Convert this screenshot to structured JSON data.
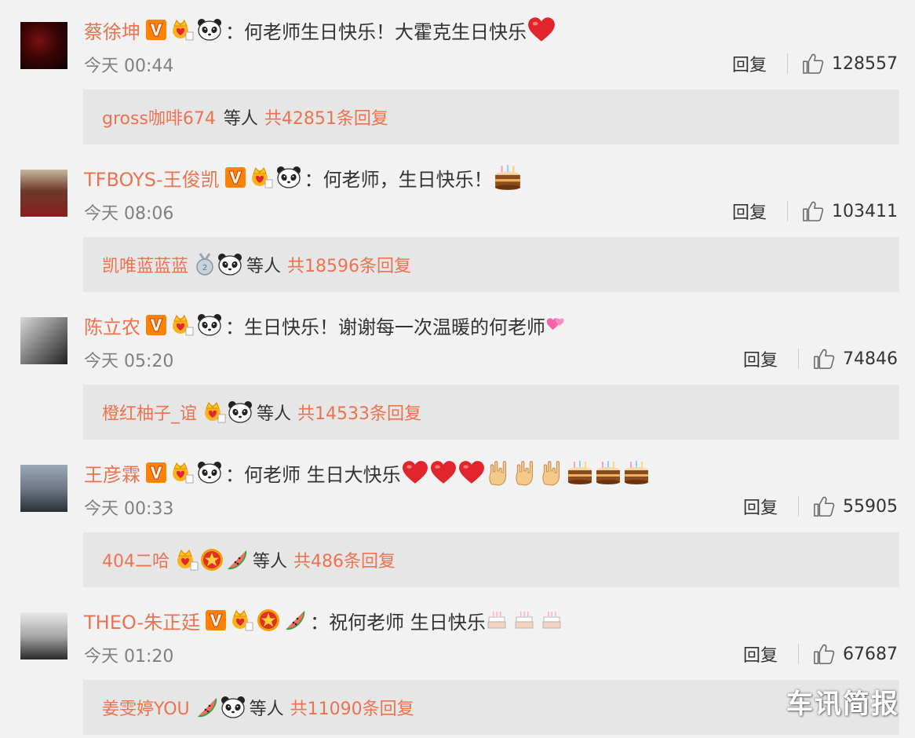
{
  "comments": [
    {
      "username": "蔡徐坤",
      "text": "何老师生日快乐！大霍克生日快乐",
      "time": "今天 00:44",
      "reply_label": "回复",
      "likes": "128557",
      "sub_user": "gross咖啡674",
      "sub_etc": "等人",
      "sub_total": "共42851条回复"
    },
    {
      "username": "TFBOYS-王俊凯",
      "text": "何老师，生日快乐！",
      "time": "今天 08:06",
      "reply_label": "回复",
      "likes": "103411",
      "sub_user": "凯唯蓝蓝蓝",
      "sub_etc": "等人",
      "sub_total": "共18596条回复"
    },
    {
      "username": "陈立农",
      "text": "生日快乐！谢谢每一次温暖的何老师",
      "time": "今天 05:20",
      "reply_label": "回复",
      "likes": "74846",
      "sub_user": "橙红柚子_谊",
      "sub_etc": "等人",
      "sub_total": "共14533条回复"
    },
    {
      "username": "王彦霖",
      "text": "何老师 生日大快乐",
      "time": "今天 00:33",
      "reply_label": "回复",
      "likes": "55905",
      "sub_user": "404二哈",
      "sub_etc": "等人",
      "sub_total": "共486条回复"
    },
    {
      "username": "THEO-朱正廷",
      "text": "祝何老师 生日快乐",
      "time": "今天 01:20",
      "reply_label": "回复",
      "likes": "67687",
      "sub_user": "姜雯婷YOU",
      "sub_etc": "等人",
      "sub_total": "共11090条回复"
    }
  ],
  "colon": "：",
  "watermark": "车讯简报",
  "colors": {
    "username": "#eb7350",
    "background": "#f2f2f2",
    "sub_bg": "#e6e6e6",
    "vip": "#ff8200"
  }
}
